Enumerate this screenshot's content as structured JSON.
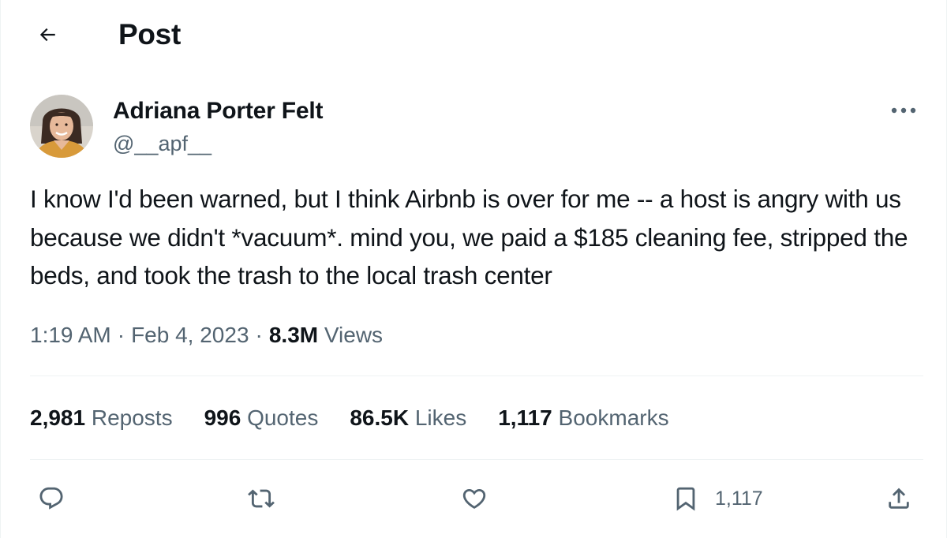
{
  "header": {
    "back_icon": "arrow-left-icon",
    "title": "Post"
  },
  "author": {
    "name": "Adriana Porter Felt",
    "handle": "@__apf__",
    "avatar_icon": "user-avatar"
  },
  "post": {
    "text": "I know I'd been warned, but I think Airbnb is over for me -- a host is angry with us because we didn't *vacuum*. mind you, we paid a $185 cleaning fee, stripped the beds, and took the trash to the local trash center",
    "time": "1:19 AM",
    "date": "Feb 4, 2023",
    "separator": "·",
    "views_count": "8.3M",
    "views_label": "Views"
  },
  "stats": {
    "reposts": {
      "count": "2,981",
      "label": "Reposts"
    },
    "quotes": {
      "count": "996",
      "label": "Quotes"
    },
    "likes": {
      "count": "86.5K",
      "label": "Likes"
    },
    "bookmarks": {
      "count": "1,117",
      "label": "Bookmarks"
    }
  },
  "actions": {
    "reply_icon": "reply-icon",
    "repost_icon": "repost-icon",
    "like_icon": "heart-icon",
    "bookmark_icon": "bookmark-icon",
    "bookmark_count": "1,117",
    "share_icon": "share-icon"
  },
  "colors": {
    "text_primary": "#0f1419",
    "text_secondary": "#536471",
    "divider": "#eff3f4"
  }
}
